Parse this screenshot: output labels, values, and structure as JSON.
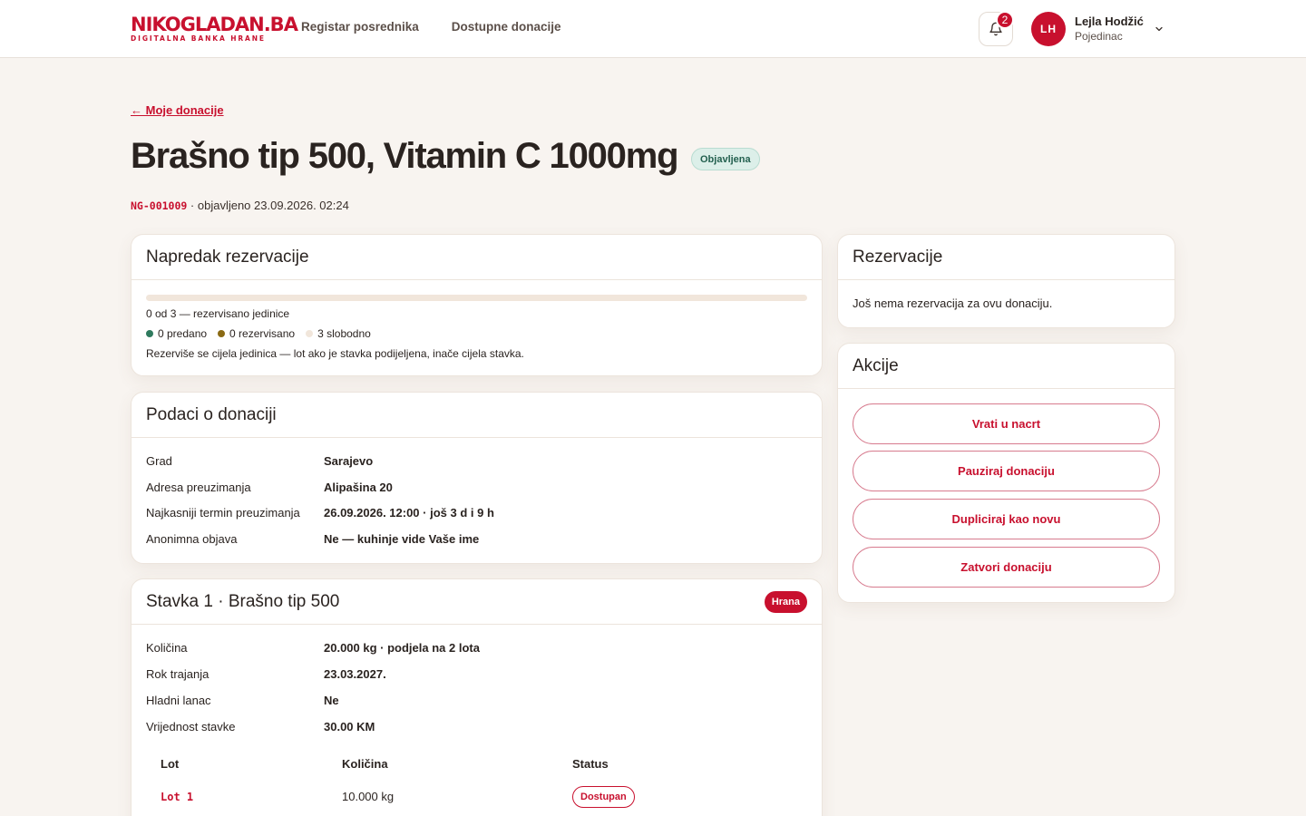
{
  "header": {
    "logo_main_a": "NIKO",
    "logo_main_b": "GLADAN.BA",
    "logo_sub": "DIGITALNA BANKA HRANE",
    "nav": [
      "Registar posrednika",
      "Dostupne donacije"
    ],
    "notifications_count": "2",
    "user": {
      "initials": "LH",
      "name": "Lejla Hodžić",
      "role": "Pojedinac"
    }
  },
  "page": {
    "back_link": "← Moje donacije",
    "title": "Brašno tip 500, Vitamin C 1000mg",
    "status": "Objavljena",
    "code": "NG-001009",
    "published": " · objavljeno 23.09.2026. 02:24"
  },
  "progress": {
    "title": "Napredak rezervacije",
    "fraction_reserved": 0,
    "summary": "0 od 3 — rezervisano jedinice",
    "legend": [
      "0 predano",
      "0 rezervisano",
      "3 slobodno"
    ],
    "legend_colors": [
      "#2f7a5e",
      "#8a6a14",
      "#f1e6db"
    ],
    "note": "Rezerviše se cijela jedinica — lot ako je stavka podijeljena, inače cijela stavka."
  },
  "details": {
    "title": "Podaci o donaciji",
    "rows": [
      {
        "label": "Grad",
        "value": "Sarajevo"
      },
      {
        "label": "Adresa preuzimanja",
        "value": "Alipašina 20"
      },
      {
        "label": "Najkasniji termin preuzimanja",
        "value": "26.09.2026. 12:00 · još 3 d i 9 h"
      },
      {
        "label": "Anonimna objava",
        "value": "Ne — kuhinje vide Vaše ime"
      }
    ]
  },
  "item": {
    "title": "Stavka 1 · Brašno tip 500",
    "category": "Hrana",
    "rows": [
      {
        "label": "Količina",
        "value": "20.000 kg · podjela na 2 lota"
      },
      {
        "label": "Rok trajanja",
        "value": "23.03.2027."
      },
      {
        "label": "Hladni lanac",
        "value": "Ne"
      },
      {
        "label": "Vrijednost stavke",
        "value": "30.00 KM"
      }
    ],
    "lot_headers": [
      "Lot",
      "Količina",
      "Status"
    ],
    "lots": [
      {
        "lot": "Lot 1",
        "quantity": "10.000 kg",
        "status": "Dostupan"
      }
    ]
  },
  "reservations": {
    "title": "Rezervacije",
    "empty_text": "Još nema rezervacija za ovu donaciju."
  },
  "actions": {
    "title": "Akcije",
    "buttons": [
      "Vrati u nacrt",
      "Pauziraj donaciju",
      "Dupliciraj kao novu",
      "Zatvori donaciju"
    ]
  },
  "colors": {
    "brand": "#c8102e",
    "background": "#f8f4f0",
    "published_bg": "#dcefe9"
  }
}
